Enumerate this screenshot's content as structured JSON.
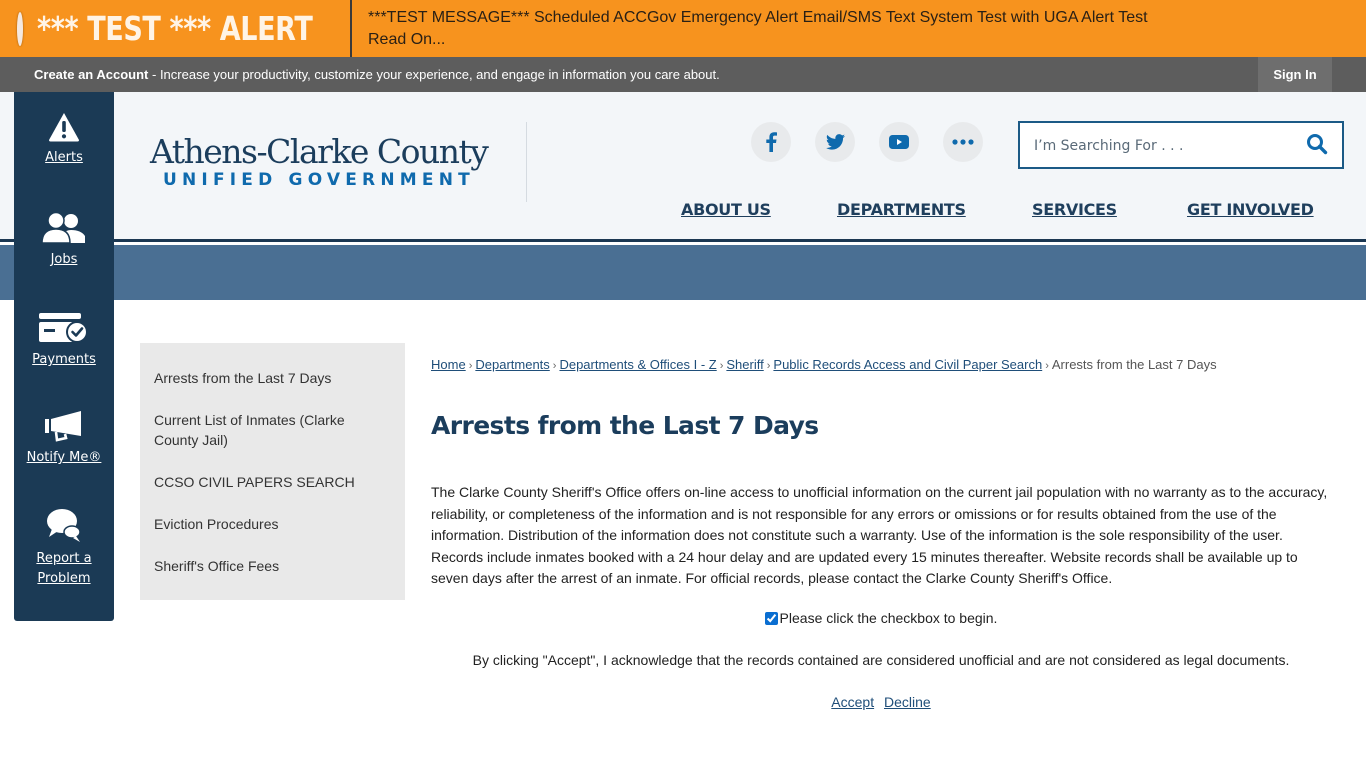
{
  "alert": {
    "title": "*** TEST *** ALERT",
    "message": "***TEST MESSAGE*** Scheduled ACCGov Emergency Alert Email/SMS Text System Test with UGA Alert Test",
    "read_on": "Read On...",
    "color": "#f7931e"
  },
  "account_bar": {
    "create_label": "Create an Account",
    "tagline": " - Increase your productivity, customize your experience, and engage in information you care about.",
    "sign_in": "Sign In"
  },
  "logo": {
    "main": "Athens-Clarke County",
    "sub": "UNIFIED GOVERNMENT"
  },
  "social": [
    {
      "name": "facebook-icon"
    },
    {
      "name": "twitter-icon"
    },
    {
      "name": "youtube-icon"
    },
    {
      "name": "more-icon"
    }
  ],
  "search": {
    "placeholder": "I’m Searching For . . .",
    "value": ""
  },
  "nav": [
    "ABOUT US",
    "DEPARTMENTS",
    "SERVICES",
    "GET INVOLVED"
  ],
  "quick_links": [
    {
      "label": "Alerts",
      "icon": "warning-icon"
    },
    {
      "label": "Jobs",
      "icon": "users-icon"
    },
    {
      "label": "Payments",
      "icon": "payment-card-icon"
    },
    {
      "label": "Notify Me®",
      "icon": "megaphone-icon"
    },
    {
      "label": "Report a Problem",
      "icon": "chat-bubbles-icon"
    }
  ],
  "sidenav": [
    "Arrests from the Last 7 Days",
    "Current List of Inmates (Clarke County Jail)",
    "CCSO CIVIL PAPERS SEARCH",
    "Eviction Procedures",
    "Sheriff's Office Fees"
  ],
  "breadcrumb": {
    "links": [
      "Home",
      "Departments",
      "Departments & Offices I - Z",
      "Sheriff",
      "Public Records Access and Civil Paper Search"
    ],
    "current": "Arrests from the Last 7 Days",
    "separator": "›"
  },
  "page_title": "Arrests from the Last 7 Days",
  "disclaimer": "The Clarke County Sheriff's Office offers on-line access to unofficial information on the current jail population with no warranty as to the accuracy, reliability, or completeness of the information and is not responsible for any errors or omissions or for results obtained from the use of the information. Distribution of the information does not constitute such a warranty. Use of the information is the sole responsibility of the user. Records include inmates booked with a 24 hour delay and are updated every 15 minutes thereafter. Website records shall be available up to seven days after the arrest of an inmate. For official records, please contact the Clarke County Sheriff's Office.",
  "checkbox": {
    "label": "Please click the checkbox to begin.",
    "checked": true
  },
  "acknowledgement": "By clicking \"Accept\", I acknowledge that the records contained are considered unofficial and are not considered as legal documents.",
  "actions": {
    "accept": "Accept",
    "decline": "Decline"
  }
}
